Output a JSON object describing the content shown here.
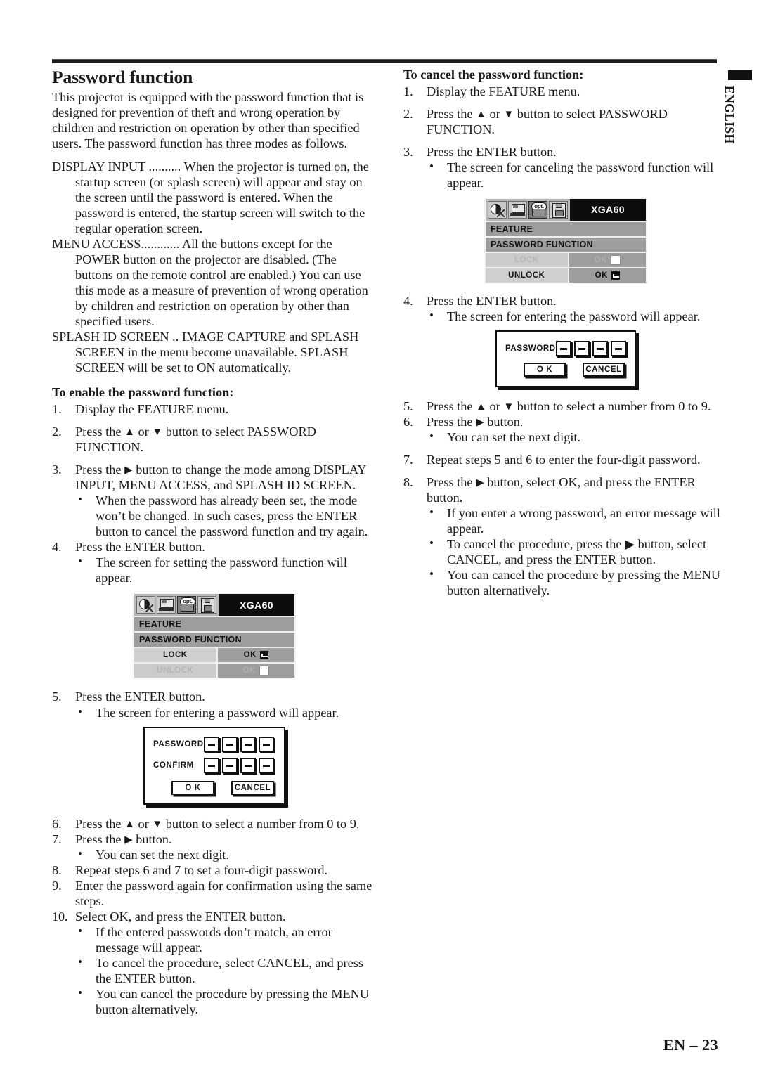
{
  "page": {
    "language_tab": "ENGLISH",
    "footer": "EN – 23"
  },
  "left_column": {
    "title": "Password function",
    "intro": "This projector is equipped with the password function that is designed for prevention of theft and wrong operation by children and restriction on operation by other than specified users. The password function has three modes as follows.",
    "modes": [
      {
        "term": "DISPLAY INPUT ..........",
        "description": "When the projector is turned on, the startup screen (or splash screen) will appear and stay on the screen until the password is entered. When the password is entered, the startup screen will switch to the regular operation screen."
      },
      {
        "term": "MENU ACCESS............",
        "description": "All the buttons except for the POWER button on the projector are disabled. (The buttons on the remote control are enabled.) You can use this mode as a measure of prevention of wrong operation by children and restriction on operation by other than specified users."
      },
      {
        "term": "SPLASH ID SCREEN ..",
        "description": "IMAGE CAPTURE and SPLASH SCREEN in the menu become unavailable. SPLASH SCREEN will be set to ON automatically."
      }
    ],
    "enable_heading": "To enable the password function:",
    "steps": [
      {
        "num": "1.",
        "text": "Display the FEATURE menu."
      },
      {
        "num": "2.",
        "text_before": "Press the ",
        "arrow_up": "▲",
        "text_mid": " or ",
        "arrow_down": "▼",
        "text_after": " button to select PASSWORD FUNCTION."
      },
      {
        "num": "3.",
        "text_before": "Press the ",
        "arrow_right": "▶",
        "text_after": " button to change the mode among DISPLAY INPUT, MENU ACCESS, and SPLASH ID SCREEN.",
        "bullets": [
          "When the password has already been set, the mode won’t be changed. In such cases, press the ENTER button to cancel the password function and try again."
        ]
      },
      {
        "num": "4.",
        "text": "Press the ENTER button.",
        "bullets": [
          "The screen for setting the password function will appear."
        ]
      },
      {
        "num": "5.",
        "text": "Press the ENTER button.",
        "bullets": [
          "The screen for entering a password will appear."
        ]
      },
      {
        "num": "6.",
        "text_before": "Press the ",
        "arrow_up": "▲",
        "text_mid": " or ",
        "arrow_down": "▼",
        "text_after": " button to select a number from 0 to 9."
      },
      {
        "num": "7.",
        "text_before": "Press the ",
        "arrow_right": "▶",
        "text_after": " button.",
        "bullets": [
          "You can set the next digit."
        ]
      },
      {
        "num": "8.",
        "text": "Repeat steps 6 and 7 to set a four-digit password."
      },
      {
        "num": "9.",
        "text": "Enter the password again for confirmation using the same steps."
      },
      {
        "num": "10.",
        "text": "Select OK, and press the ENTER button.",
        "bullets": [
          "If the entered passwords don’t match, an error message will appear.",
          "To cancel the procedure, select CANCEL, and press the ENTER button.",
          "You can cancel the procedure by pressing the MENU button alternatively."
        ]
      }
    ],
    "osd_lock": {
      "signal": "XGA60",
      "menu_title": "FEATURE",
      "menu_item": "PASSWORD FUNCTION",
      "rows": [
        {
          "label": "LOCK",
          "value": "OK",
          "glyph": "enter-glyph",
          "dimmed": false
        },
        {
          "label": "UNLOCK",
          "value": "OK",
          "glyph": "blank-glyph",
          "dimmed": true
        }
      ],
      "icons": [
        "contrast-icon",
        "screen-icon",
        "opt-icon",
        "signal-icon"
      ],
      "selected_icon_index": 2,
      "opt_icon_label": "opt."
    },
    "password_dialog": {
      "rows": [
        {
          "label": "PASSWORD",
          "digits": [
            "–",
            "–",
            "–",
            "–"
          ]
        },
        {
          "label": "CONFIRM",
          "digits": [
            "–",
            "–",
            "–",
            "–"
          ]
        }
      ],
      "ok_label": "O K",
      "cancel_label": "CANCEL"
    }
  },
  "right_column": {
    "cancel_heading": "To cancel the password function:",
    "steps": [
      {
        "num": "1.",
        "text": "Display the FEATURE menu."
      },
      {
        "num": "2.",
        "text_before": "Press the ",
        "arrow_up": "▲",
        "text_mid": " or ",
        "arrow_down": "▼",
        "text_after": " button to select PASSWORD FUNCTION."
      },
      {
        "num": "3.",
        "text": "Press the ENTER button.",
        "bullets": [
          "The screen for canceling the password function will appear."
        ]
      },
      {
        "num": "4.",
        "text": "Press the ENTER button.",
        "bullets": [
          "The screen for entering the password will appear."
        ]
      },
      {
        "num": "5.",
        "text_before": "Press the ",
        "arrow_up": "▲",
        "text_mid": " or ",
        "arrow_down": "▼",
        "text_after": " button to select a number from 0 to 9."
      },
      {
        "num": "6.",
        "text_before": "Press the ",
        "arrow_right": "▶",
        "text_after": " button.",
        "bullets": [
          "You can set the next digit."
        ]
      },
      {
        "num": "7.",
        "text": "Repeat steps 5 and 6 to enter the four-digit password."
      },
      {
        "num": "8.",
        "text_before": "Press the ",
        "arrow_right": "▶",
        "text_after": " button, select OK, and press the ENTER button.",
        "bullets": [
          "If you enter a wrong password, an error message will appear.",
          "To cancel the procedure, press the ▶ button, select CANCEL, and press the ENTER button.",
          "You can cancel the procedure by pressing the MENU button alternatively."
        ]
      }
    ],
    "osd_unlock": {
      "signal": "XGA60",
      "menu_title": "FEATURE",
      "menu_item": "PASSWORD FUNCTION",
      "rows": [
        {
          "label": "LOCK",
          "value": "OK",
          "glyph": "blank-glyph",
          "dimmed": true
        },
        {
          "label": "UNLOCK",
          "value": "OK",
          "glyph": "enter-glyph",
          "dimmed": false
        }
      ],
      "icons": [
        "contrast-icon",
        "screen-icon",
        "opt-icon",
        "signal-icon"
      ],
      "selected_icon_index": 2,
      "opt_icon_label": "opt."
    },
    "password_dialog": {
      "rows": [
        {
          "label": "PASSWORD",
          "digits": [
            "–",
            "–",
            "–",
            "–"
          ]
        }
      ],
      "ok_label": "O K",
      "cancel_label": "CANCEL"
    }
  }
}
